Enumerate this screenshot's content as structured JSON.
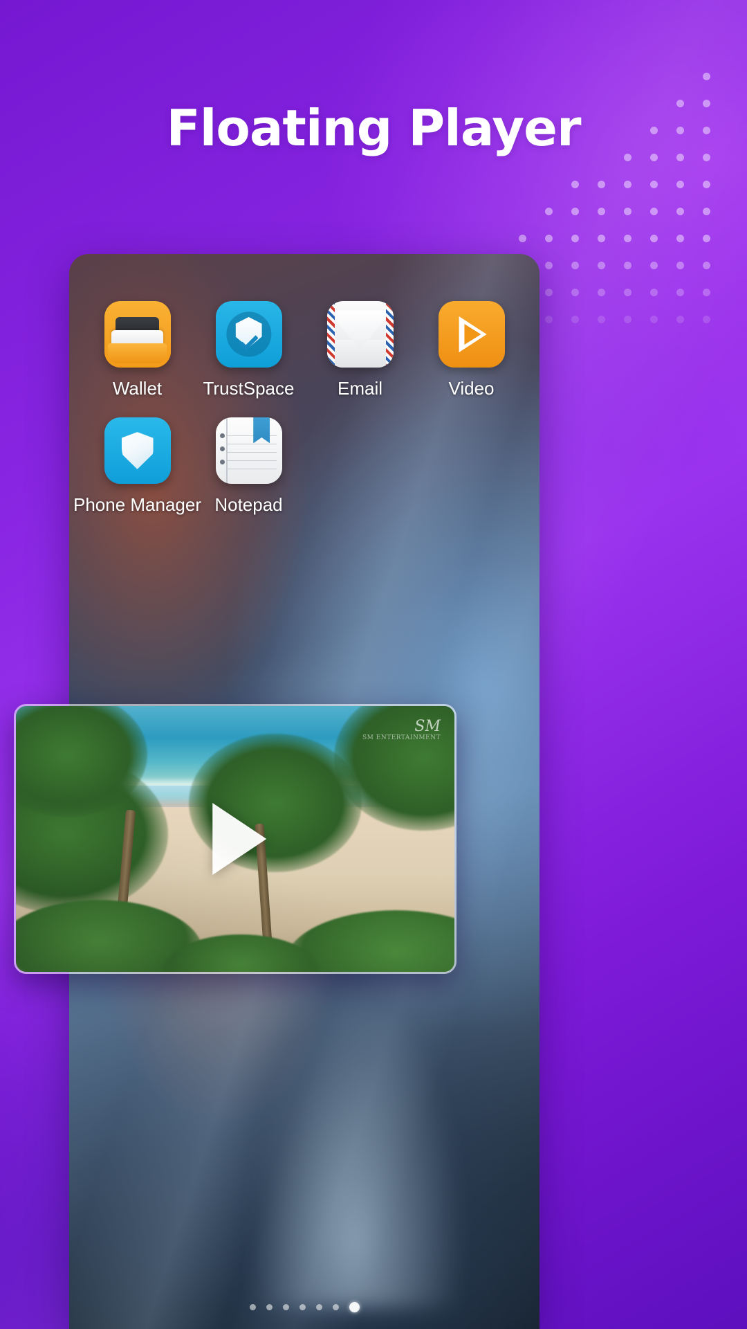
{
  "page": {
    "title": "Floating Player",
    "background_color": "#8825e2",
    "accent_color": "#ffffff"
  },
  "decoration": {
    "dot_pattern_color": "#c79cf0",
    "dot_rows": 10,
    "dot_cols": 8
  },
  "phone": {
    "home_screen": {
      "apps": [
        {
          "label": "Wallet",
          "icon": "wallet-icon",
          "color": "#f39a19"
        },
        {
          "label": "TrustSpace",
          "icon": "shield-check-icon",
          "color": "#0f9fd8"
        },
        {
          "label": "Email",
          "icon": "envelope-icon",
          "color": "#e4e6e8"
        },
        {
          "label": "Video",
          "icon": "play-triangle-icon",
          "color": "#ef8f12"
        },
        {
          "label": "Phone Manager",
          "icon": "shield-icon",
          "color": "#0f9ed8"
        },
        {
          "label": "Notepad",
          "icon": "notepad-icon",
          "color": "#e9ebed"
        }
      ]
    },
    "page_indicator": {
      "total": 7,
      "active_index": 6
    }
  },
  "floating_player": {
    "name": "floating-video-player",
    "play_button_label": "play-triangle-icon",
    "watermark": "SM",
    "watermark_sub": "SM ENTERTAINMENT",
    "state": "paused"
  }
}
